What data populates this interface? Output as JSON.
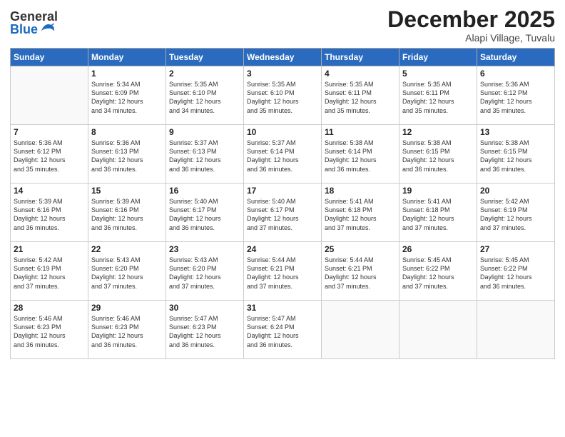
{
  "logo": {
    "general": "General",
    "blue": "Blue"
  },
  "header": {
    "month": "December 2025",
    "location": "Alapi Village, Tuvalu"
  },
  "weekdays": [
    "Sunday",
    "Monday",
    "Tuesday",
    "Wednesday",
    "Thursday",
    "Friday",
    "Saturday"
  ],
  "weeks": [
    [
      {
        "day": "",
        "info": ""
      },
      {
        "day": "1",
        "info": "Sunrise: 5:34 AM\nSunset: 6:09 PM\nDaylight: 12 hours\nand 34 minutes."
      },
      {
        "day": "2",
        "info": "Sunrise: 5:35 AM\nSunset: 6:10 PM\nDaylight: 12 hours\nand 34 minutes."
      },
      {
        "day": "3",
        "info": "Sunrise: 5:35 AM\nSunset: 6:10 PM\nDaylight: 12 hours\nand 35 minutes."
      },
      {
        "day": "4",
        "info": "Sunrise: 5:35 AM\nSunset: 6:11 PM\nDaylight: 12 hours\nand 35 minutes."
      },
      {
        "day": "5",
        "info": "Sunrise: 5:35 AM\nSunset: 6:11 PM\nDaylight: 12 hours\nand 35 minutes."
      },
      {
        "day": "6",
        "info": "Sunrise: 5:36 AM\nSunset: 6:12 PM\nDaylight: 12 hours\nand 35 minutes."
      }
    ],
    [
      {
        "day": "7",
        "info": "Sunrise: 5:36 AM\nSunset: 6:12 PM\nDaylight: 12 hours\nand 35 minutes."
      },
      {
        "day": "8",
        "info": "Sunrise: 5:36 AM\nSunset: 6:13 PM\nDaylight: 12 hours\nand 36 minutes."
      },
      {
        "day": "9",
        "info": "Sunrise: 5:37 AM\nSunset: 6:13 PM\nDaylight: 12 hours\nand 36 minutes."
      },
      {
        "day": "10",
        "info": "Sunrise: 5:37 AM\nSunset: 6:14 PM\nDaylight: 12 hours\nand 36 minutes."
      },
      {
        "day": "11",
        "info": "Sunrise: 5:38 AM\nSunset: 6:14 PM\nDaylight: 12 hours\nand 36 minutes."
      },
      {
        "day": "12",
        "info": "Sunrise: 5:38 AM\nSunset: 6:15 PM\nDaylight: 12 hours\nand 36 minutes."
      },
      {
        "day": "13",
        "info": "Sunrise: 5:38 AM\nSunset: 6:15 PM\nDaylight: 12 hours\nand 36 minutes."
      }
    ],
    [
      {
        "day": "14",
        "info": "Sunrise: 5:39 AM\nSunset: 6:16 PM\nDaylight: 12 hours\nand 36 minutes."
      },
      {
        "day": "15",
        "info": "Sunrise: 5:39 AM\nSunset: 6:16 PM\nDaylight: 12 hours\nand 36 minutes."
      },
      {
        "day": "16",
        "info": "Sunrise: 5:40 AM\nSunset: 6:17 PM\nDaylight: 12 hours\nand 36 minutes."
      },
      {
        "day": "17",
        "info": "Sunrise: 5:40 AM\nSunset: 6:17 PM\nDaylight: 12 hours\nand 37 minutes."
      },
      {
        "day": "18",
        "info": "Sunrise: 5:41 AM\nSunset: 6:18 PM\nDaylight: 12 hours\nand 37 minutes."
      },
      {
        "day": "19",
        "info": "Sunrise: 5:41 AM\nSunset: 6:18 PM\nDaylight: 12 hours\nand 37 minutes."
      },
      {
        "day": "20",
        "info": "Sunrise: 5:42 AM\nSunset: 6:19 PM\nDaylight: 12 hours\nand 37 minutes."
      }
    ],
    [
      {
        "day": "21",
        "info": "Sunrise: 5:42 AM\nSunset: 6:19 PM\nDaylight: 12 hours\nand 37 minutes."
      },
      {
        "day": "22",
        "info": "Sunrise: 5:43 AM\nSunset: 6:20 PM\nDaylight: 12 hours\nand 37 minutes."
      },
      {
        "day": "23",
        "info": "Sunrise: 5:43 AM\nSunset: 6:20 PM\nDaylight: 12 hours\nand 37 minutes."
      },
      {
        "day": "24",
        "info": "Sunrise: 5:44 AM\nSunset: 6:21 PM\nDaylight: 12 hours\nand 37 minutes."
      },
      {
        "day": "25",
        "info": "Sunrise: 5:44 AM\nSunset: 6:21 PM\nDaylight: 12 hours\nand 37 minutes."
      },
      {
        "day": "26",
        "info": "Sunrise: 5:45 AM\nSunset: 6:22 PM\nDaylight: 12 hours\nand 37 minutes."
      },
      {
        "day": "27",
        "info": "Sunrise: 5:45 AM\nSunset: 6:22 PM\nDaylight: 12 hours\nand 36 minutes."
      }
    ],
    [
      {
        "day": "28",
        "info": "Sunrise: 5:46 AM\nSunset: 6:23 PM\nDaylight: 12 hours\nand 36 minutes."
      },
      {
        "day": "29",
        "info": "Sunrise: 5:46 AM\nSunset: 6:23 PM\nDaylight: 12 hours\nand 36 minutes."
      },
      {
        "day": "30",
        "info": "Sunrise: 5:47 AM\nSunset: 6:23 PM\nDaylight: 12 hours\nand 36 minutes."
      },
      {
        "day": "31",
        "info": "Sunrise: 5:47 AM\nSunset: 6:24 PM\nDaylight: 12 hours\nand 36 minutes."
      },
      {
        "day": "",
        "info": ""
      },
      {
        "day": "",
        "info": ""
      },
      {
        "day": "",
        "info": ""
      }
    ]
  ]
}
